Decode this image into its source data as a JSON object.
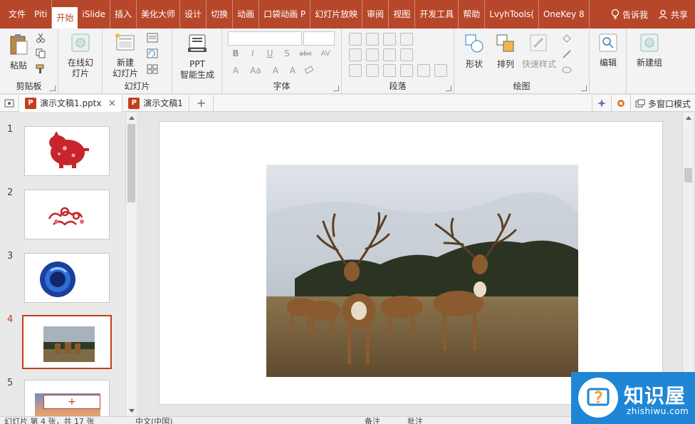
{
  "menu": {
    "items": [
      "文件",
      "Piti",
      "开始",
      "iSlide",
      "插入",
      "美化大师",
      "设计",
      "切换",
      "动画",
      "口袋动画 P",
      "幻灯片放映",
      "审阅",
      "视图",
      "开发工具",
      "帮助",
      "LvyhTools(",
      "OneKey 8"
    ],
    "active_index": 2,
    "tell_me": "告诉我",
    "share": "共享"
  },
  "ribbon": {
    "clipboard": {
      "paste": "粘贴",
      "label": "剪贴板"
    },
    "online": {
      "line1": "在线幻",
      "line2": "灯片"
    },
    "slides": {
      "new_line1": "新建",
      "new_line2": "幻灯片",
      "label": "幻灯片"
    },
    "ppt_ai": {
      "line1": "PPT",
      "line2": "智能生成"
    },
    "font": {
      "label": "字体",
      "buttons": [
        "B",
        "I",
        "U",
        "S",
        "abc",
        "AV",
        "A",
        "Aa",
        "A",
        "A"
      ]
    },
    "paragraph": {
      "label": "段落"
    },
    "drawing": {
      "shape": "形状",
      "arrange": "排列",
      "quick_style": "快速样式",
      "label": "绘图"
    },
    "editing": {
      "edit": "编辑"
    },
    "new_group": {
      "label": "新建组"
    }
  },
  "tabs": {
    "doc1": "演示文稿1.pptx",
    "doc2": "演示文稿1",
    "multi_window": "多窗口模式",
    "badge": "P"
  },
  "slides_panel": {
    "numbers": [
      "1",
      "2",
      "3",
      "4",
      "5"
    ],
    "active": "4",
    "add_symbol": "+"
  },
  "status": {
    "slide_info": "幻灯片 第 4 张，共 17 张",
    "language": "中文(中国)",
    "notes": "备注",
    "comments": "批注"
  },
  "watermark": {
    "title": "知识屋",
    "subtitle": "zhishiwu.com"
  },
  "colors": {
    "accent": "#b7472a",
    "brand_red": "#c43e1c",
    "watermark_blue": "#1f86d6"
  }
}
